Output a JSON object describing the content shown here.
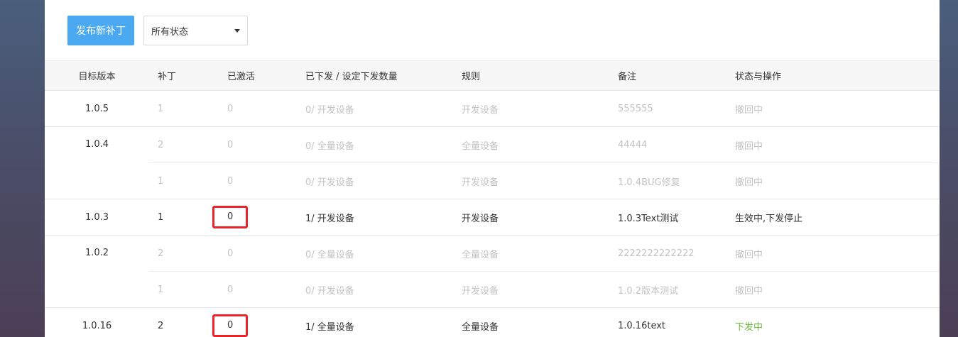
{
  "toolbar": {
    "publish_button": "发布新补丁",
    "status_select": "所有状态"
  },
  "table": {
    "headers": {
      "target_version": "目标版本",
      "patch": "补丁",
      "activated": "已激活",
      "issued": "已下发 / 设定下发数量",
      "rule": "规则",
      "remark": "备注",
      "status": "状态与操作"
    },
    "rows": [
      {
        "version": "1.0.5",
        "patch": "1",
        "activated": "0",
        "issued": "0/ 开发设备",
        "rule": "开发设备",
        "remark": "555555",
        "status": "撤回中"
      },
      {
        "version": "1.0.4",
        "patch": "2",
        "activated": "0",
        "issued": "0/ 全量设备",
        "rule": "全量设备",
        "remark": "44444",
        "status": "撤回中"
      },
      {
        "version": "",
        "patch": "1",
        "activated": "0",
        "issued": "0/ 开发设备",
        "rule": "开发设备",
        "remark": "1.0.4BUG修复",
        "status": "撤回中"
      },
      {
        "version": "1.0.3",
        "patch": "1",
        "activated": "0",
        "issued": "1/ 开发设备",
        "rule": "开发设备",
        "remark": "1.0.3Text测试",
        "status": "生效中,下发停止"
      },
      {
        "version": "1.0.2",
        "patch": "2",
        "activated": "0",
        "issued": "0/ 全量设备",
        "rule": "全量设备",
        "remark": "2222222222222",
        "status": "撤回中"
      },
      {
        "version": "",
        "patch": "1",
        "activated": "0",
        "issued": "0/ 开发设备",
        "rule": "开发设备",
        "remark": "1.0.2版本测试",
        "status": "撤回中"
      },
      {
        "version": "1.0.16",
        "patch": "2",
        "activated": "0",
        "issued": "1/ 全量设备",
        "rule": "全量设备",
        "remark": "1.0.16text",
        "status": "下发中"
      }
    ]
  },
  "colors": {
    "primary": "#4aa9f0",
    "muted_text": "#c3c3c3",
    "active_status": "#6dbb3d",
    "highlight_box": "#e8232a"
  }
}
